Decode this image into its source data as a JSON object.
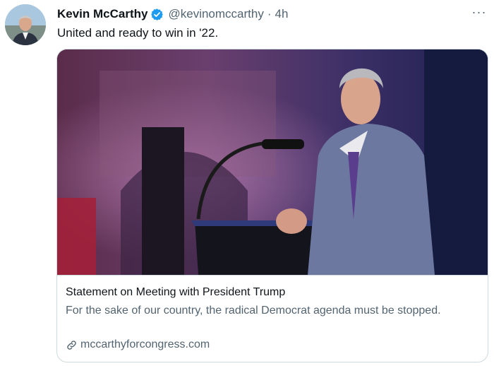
{
  "tweet": {
    "author_name": "Kevin McCarthy",
    "handle": "@kevinomccarthy",
    "separator": "·",
    "time": "4h",
    "more_label": "···",
    "text": "United and ready to win in '22."
  },
  "card": {
    "title": "Statement on Meeting with President Trump",
    "description": "For the sake of our country, the radical Democrat agenda must be stopped.",
    "domain": "mccarthyforcongress.com"
  },
  "icons": {
    "verified": "verified-badge-icon",
    "more": "more-options-icon",
    "link": "link-icon"
  },
  "colors": {
    "verified_blue": "#1d9bf0",
    "secondary_text": "#536471",
    "border": "#cfd9de"
  }
}
